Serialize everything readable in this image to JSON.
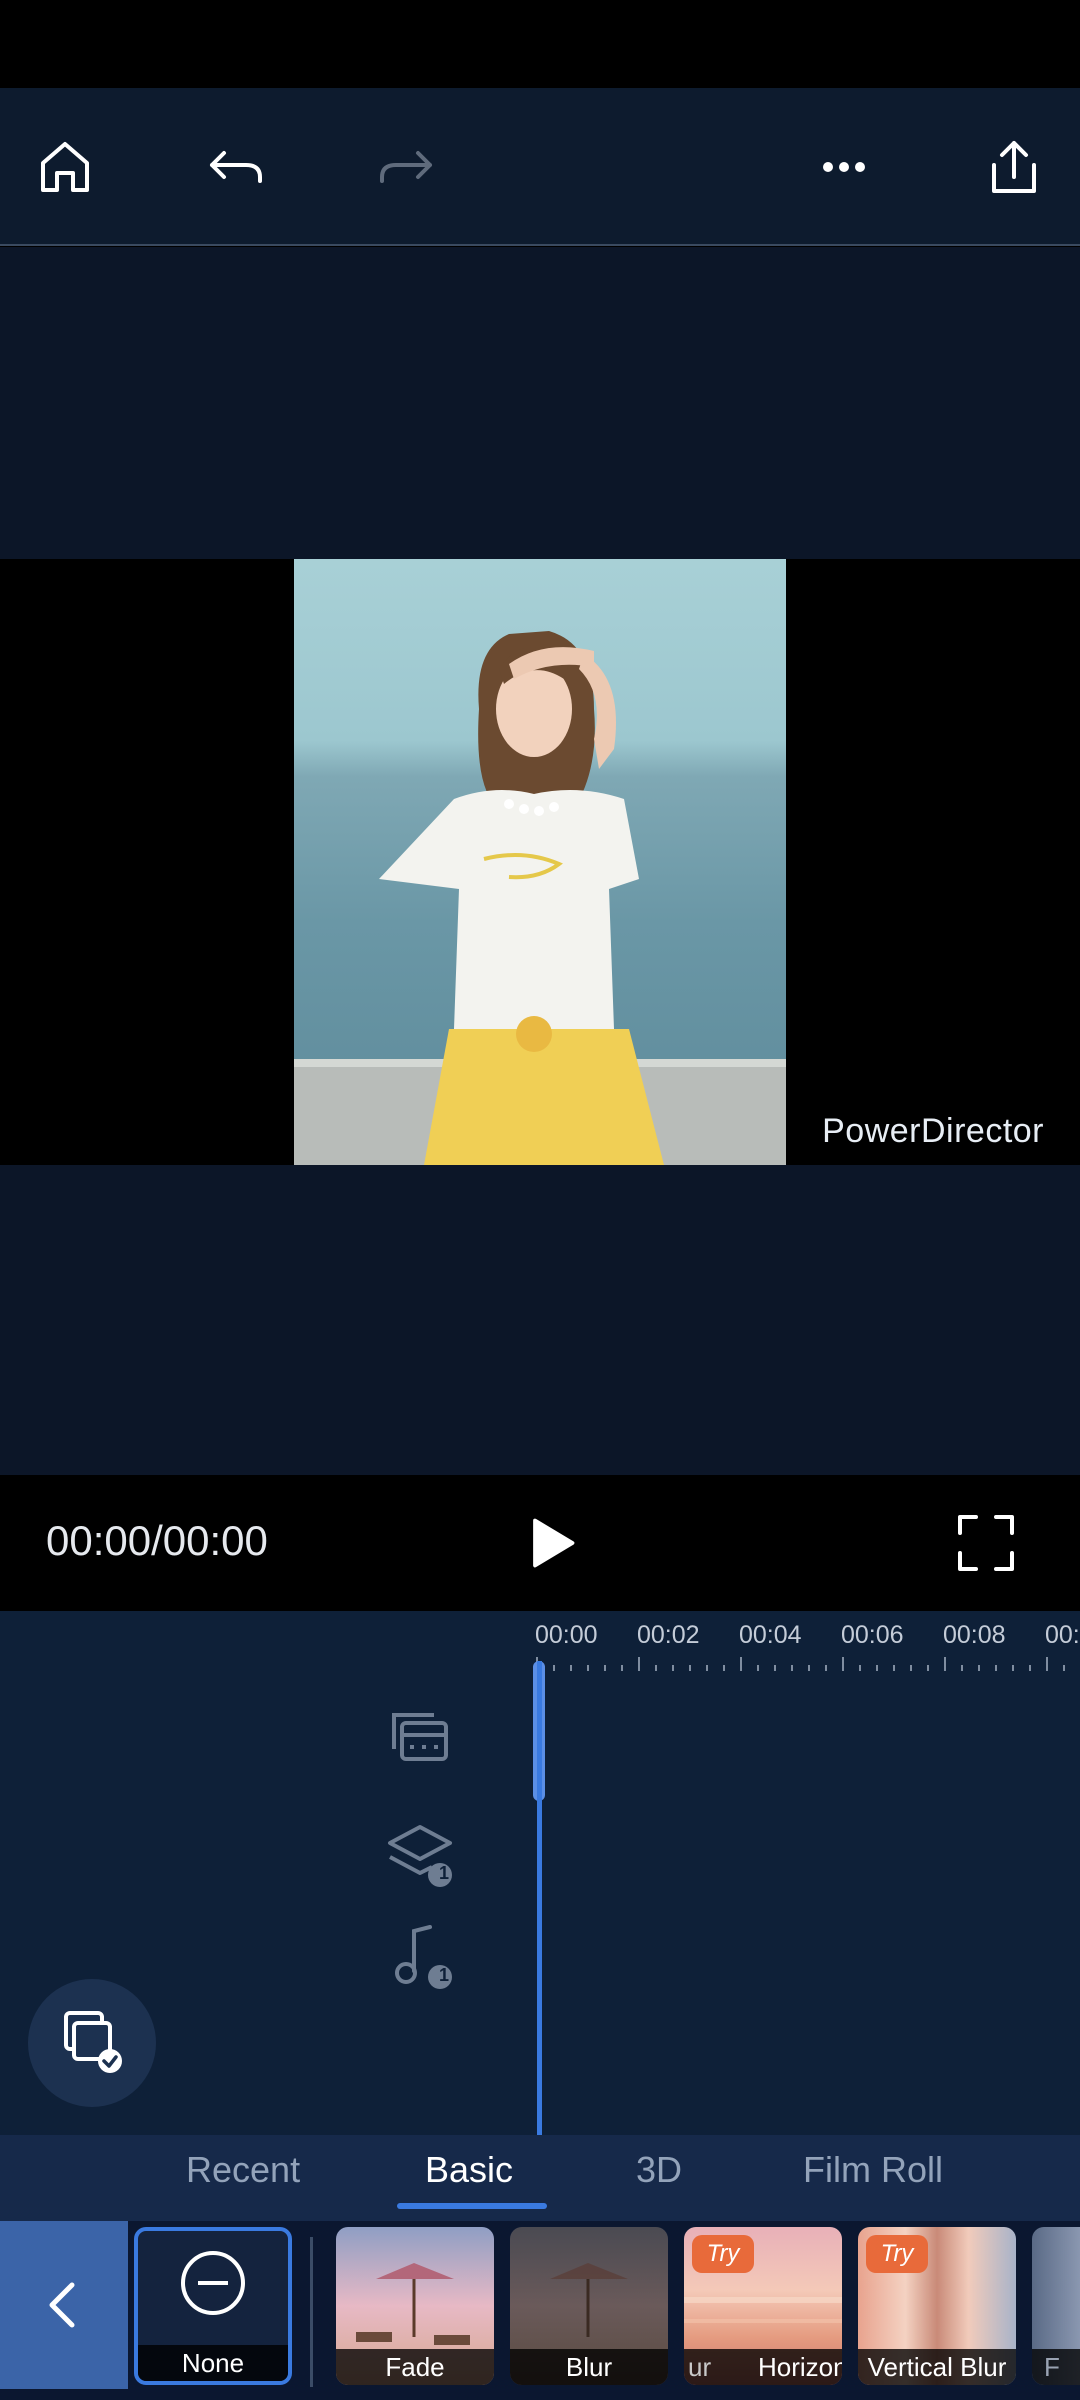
{
  "player": {
    "watermark": "PowerDirector",
    "time": "00:00/00:00"
  },
  "timeline": {
    "ruler": [
      "00:00",
      "00:02",
      "00:04",
      "00:06",
      "00:08",
      "00:"
    ],
    "overlay_badge": "1",
    "music_badge": "1"
  },
  "tabs": [
    {
      "label": "Recent",
      "active": false
    },
    {
      "label": "Basic",
      "active": true
    },
    {
      "label": "3D",
      "active": false
    },
    {
      "label": "Film Roll",
      "active": false
    }
  ],
  "transitions": {
    "try_label": "Try",
    "items": [
      {
        "label": "None",
        "selected": true
      },
      {
        "label": "Fade"
      },
      {
        "label": "Blur"
      },
      {
        "label": "ur"
      },
      {
        "label": "Horizon"
      },
      {
        "label": "Vertical Blur"
      },
      {
        "label": "F"
      }
    ]
  },
  "colors": {
    "accent": "#3a7ae0",
    "toolbar_bg": "#0d1b2e",
    "timeline_bg": "#0e2038",
    "try_badge": "#e86a3a"
  }
}
